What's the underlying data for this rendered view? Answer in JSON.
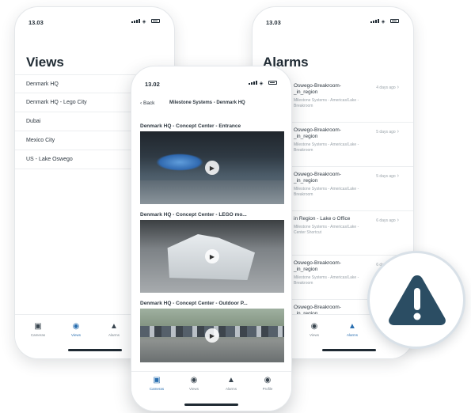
{
  "colors": {
    "accent": "#2a6fb0",
    "alert": "#2b4d63"
  },
  "left_phone": {
    "time": "13.03",
    "title": "Views",
    "views": [
      "Denmark HQ",
      "Denmark HQ - Lego City",
      "Dubai",
      "Mexico City",
      "US - Lake Oswego"
    ],
    "tabs": [
      {
        "label": "Cameras",
        "icon": "camera-icon"
      },
      {
        "label": "Views",
        "icon": "eye-icon",
        "active": true
      },
      {
        "label": "Alarms",
        "icon": "alarm-icon"
      }
    ]
  },
  "right_phone": {
    "time": "13.03",
    "title": "Alarms",
    "alarms": [
      {
        "title": "Oswego-Breakroom-_in_region",
        "sub": "Milestone Systems - Americas/Lake - Breakroom",
        "time": "4 days ago"
      },
      {
        "title": "Oswego-Breakroom-_in_region",
        "sub": "Milestone Systems - Americas/Lake - Breakroom",
        "time": "5 days ago"
      },
      {
        "title": "Oswego-Breakroom-_in_region",
        "sub": "Milestone Systems - Americas/Lake - Breakroom",
        "time": "5 days ago"
      },
      {
        "title": "in Region - Lake o Office",
        "sub": "Milestone Systems - Americas/Lake - Center Shortcut",
        "time": "6 days ago"
      },
      {
        "title": "Oswego-Breakroom-_in_region",
        "sub": "Milestone Systems - Americas/Lake - Breakroom",
        "time": "6 days ago"
      },
      {
        "title": "Oswego-Breakroom-_in_region",
        "sub": "",
        "time": ""
      }
    ],
    "tabs": [
      {
        "label": "Views",
        "icon": "eye-icon"
      },
      {
        "label": "Alarms",
        "icon": "alarm-icon",
        "active": true
      }
    ]
  },
  "front_phone": {
    "time": "13.02",
    "back_label": "Back",
    "nav_title": "Milestone Systems - Denmark HQ",
    "feeds": [
      "Denmark HQ - Concept Center - Entrance",
      "Denmark HQ - Concept Center - LEGO mo...",
      "Denmark HQ - Concept Center - Outdoor P..."
    ],
    "tabs": [
      {
        "label": "Cameras",
        "icon": "camera-icon",
        "active": true
      },
      {
        "label": "Views",
        "icon": "eye-icon"
      },
      {
        "label": "Alarms",
        "icon": "alarm-icon"
      },
      {
        "label": "Profile",
        "icon": "profile-icon"
      }
    ]
  }
}
